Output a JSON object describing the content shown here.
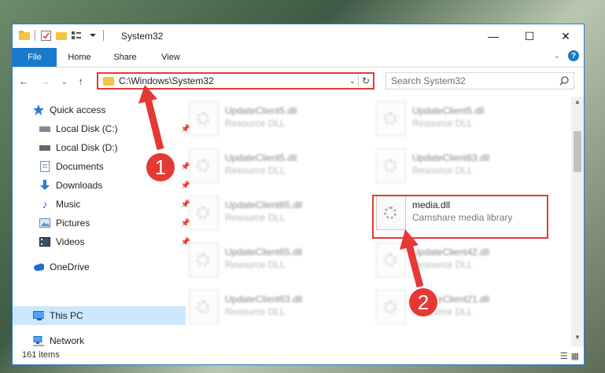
{
  "window": {
    "title": "System32"
  },
  "ribbon": {
    "tabs": [
      "File",
      "Home",
      "Share",
      "View"
    ]
  },
  "address": {
    "path": "C:\\Windows\\System32"
  },
  "search": {
    "placeholder": "Search System32"
  },
  "nav": {
    "items": [
      {
        "label": "Quick access",
        "icon": "star-icon"
      },
      {
        "label": "Local Disk (C:)",
        "icon": "drive-icon"
      },
      {
        "label": "Local Disk (D:)",
        "icon": "drive-icon"
      },
      {
        "label": "Documents",
        "icon": "documents-icon"
      },
      {
        "label": "Downloads",
        "icon": "download-icon"
      },
      {
        "label": "Music",
        "icon": "music-icon"
      },
      {
        "label": "Pictures",
        "icon": "pictures-icon"
      },
      {
        "label": "Videos",
        "icon": "videos-icon"
      },
      {
        "label": "OneDrive",
        "icon": "cloud-icon"
      },
      {
        "label": "This PC",
        "icon": "pc-icon"
      },
      {
        "label": "Network",
        "icon": "network-icon"
      }
    ]
  },
  "files": {
    "left": [
      {
        "name": "UpdateClient5.dll",
        "desc": "Resource DLL"
      },
      {
        "name": "UpdateClient5.dll",
        "desc": "Resource DLL"
      },
      {
        "name": "UpdateClient65.dll",
        "desc": "Resource DLL"
      },
      {
        "name": "UpdateClient65.dll",
        "desc": "Resource DLL"
      },
      {
        "name": "UpdateClient63.dll",
        "desc": "Resource DLL"
      }
    ],
    "right": [
      {
        "name": "UpdateClient5.dll",
        "desc": "Resource DLL"
      },
      {
        "name": "UpdateClient63.dll",
        "desc": "Resource DLL"
      },
      {
        "name": "media.dll",
        "desc": "Camshare media library"
      },
      {
        "name": "UpdateClient42.dll",
        "desc": "Resource DLL"
      },
      {
        "name": "UpdateClient21.dll",
        "desc": "Resource DLL"
      }
    ]
  },
  "status": {
    "count": "161 items"
  },
  "markers": {
    "one": "1",
    "two": "2"
  },
  "colors": {
    "accent": "#1979ca",
    "highlight": "#e53935",
    "selected": "#cce8ff"
  }
}
